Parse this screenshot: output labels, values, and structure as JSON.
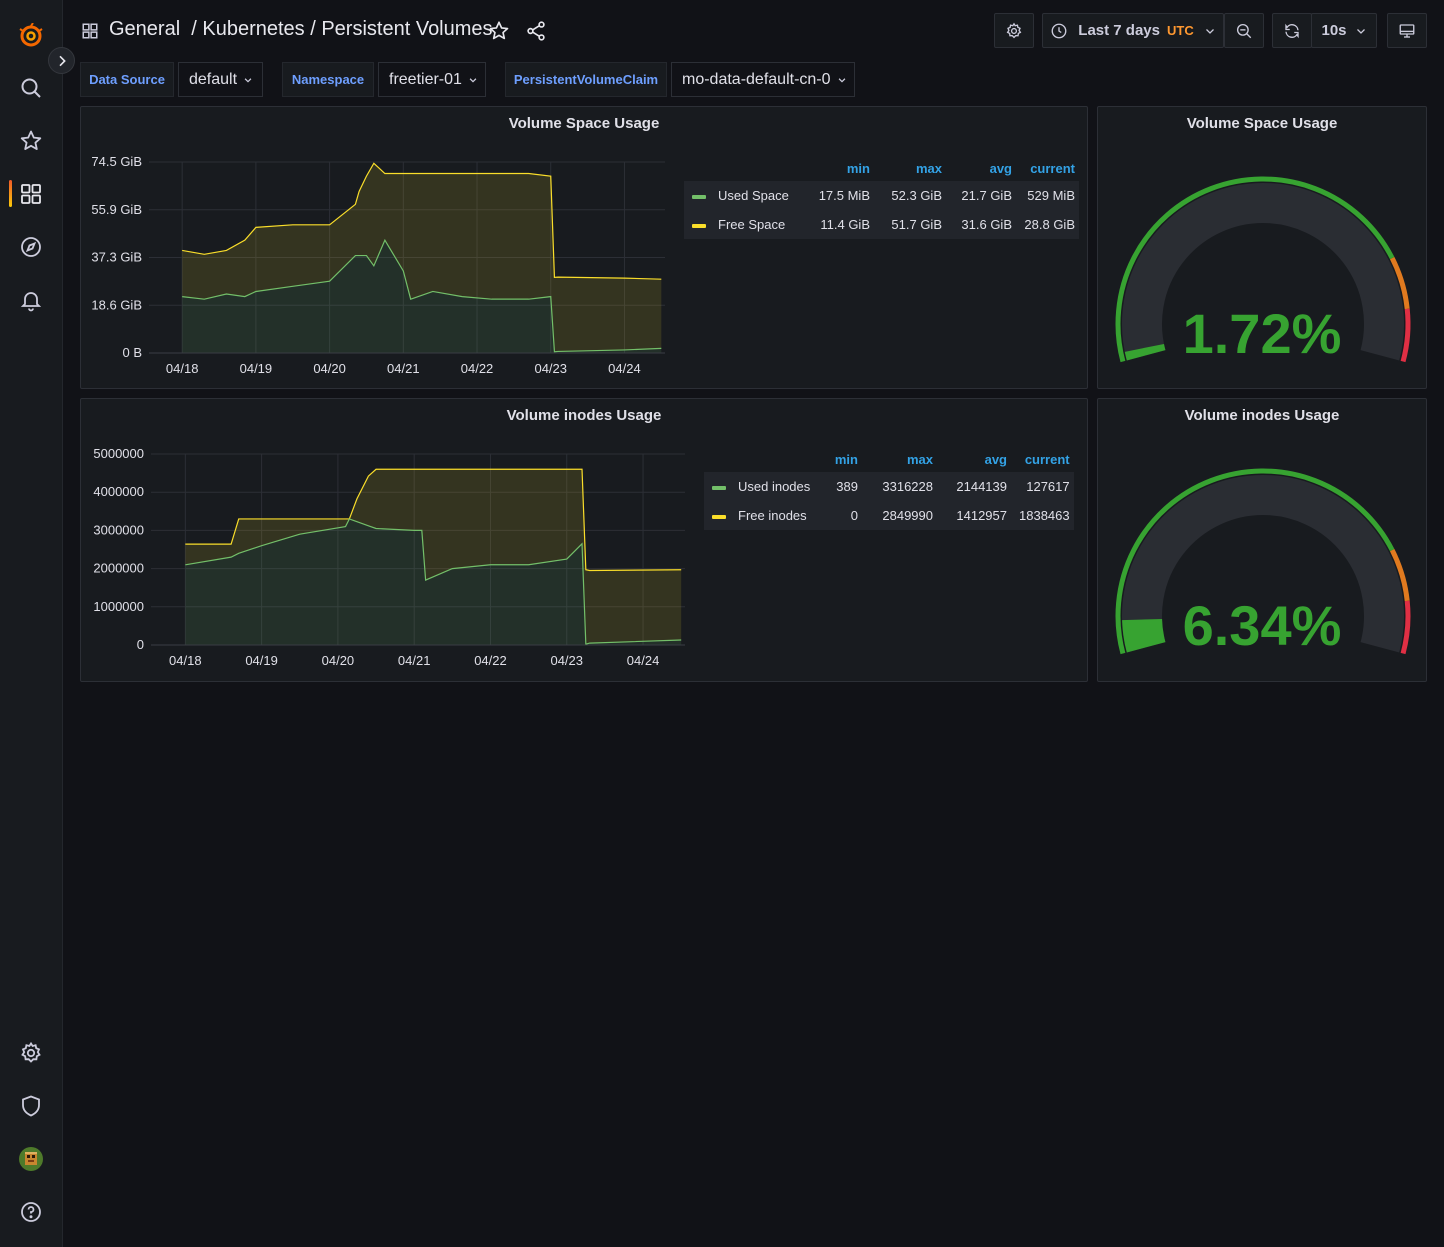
{
  "breadcrumb": {
    "text": "General  / Kubernetes / Persistent Volumes"
  },
  "toolbar": {
    "time_range": "Last 7 days",
    "timezone": "UTC",
    "refresh_interval": "10s"
  },
  "variables": [
    {
      "label": "Data Source",
      "value": "default"
    },
    {
      "label": "Namespace",
      "value": "freetier-01"
    },
    {
      "label": "PersistentVolumeClaim",
      "value": "mo-data-default-cn-0"
    }
  ],
  "colors": {
    "used": "#73bf69",
    "free": "#fade2a",
    "gauge_green": "#37a331",
    "gauge_orange": "#e07a1f",
    "gauge_red": "#e02f44",
    "accent": "#33a2e5"
  },
  "space_panel": {
    "title": "Volume Space Usage",
    "legend_headers": [
      "min",
      "max",
      "avg",
      "current"
    ],
    "legend": [
      {
        "name": "Used Space",
        "min": "17.5 MiB",
        "max": "52.3 GiB",
        "avg": "21.7 GiB",
        "current": "529 MiB"
      },
      {
        "name": "Free Space",
        "min": "11.4 GiB",
        "max": "51.7 GiB",
        "avg": "31.6 GiB",
        "current": "28.8 GiB"
      }
    ]
  },
  "inodes_panel": {
    "title": "Volume inodes Usage",
    "legend_headers": [
      "min",
      "max",
      "avg",
      "current"
    ],
    "legend": [
      {
        "name": "Used inodes",
        "min": "389",
        "max": "3316228",
        "avg": "2144139",
        "current": "127617"
      },
      {
        "name": "Free inodes",
        "min": "0",
        "max": "2849990",
        "avg": "1412957",
        "current": "1838463"
      }
    ]
  },
  "space_gauge": {
    "title": "Volume Space Usage",
    "value_text": "1.72%",
    "value": 1.72
  },
  "inodes_gauge": {
    "title": "Volume inodes Usage",
    "value_text": "6.34%",
    "value": 6.34
  },
  "chart_data": [
    {
      "type": "area",
      "title": "Volume Space Usage",
      "x_labels": [
        "04/18",
        "04/19",
        "04/20",
        "04/21",
        "04/22",
        "04/23",
        "04/24"
      ],
      "y_ticks": [
        "74.5 GiB",
        "55.9 GiB",
        "37.3 GiB",
        "18.6 GiB",
        "0 B"
      ],
      "ylim": [
        0,
        74.5
      ],
      "y_unit": "GiB",
      "stacked": true,
      "series": [
        {
          "name": "Used Space",
          "x": [
            0,
            0.3,
            0.6,
            0.85,
            1.0,
            1.5,
            2.0,
            2.35,
            2.4,
            2.5,
            2.6,
            2.75,
            3.0,
            3.1,
            3.4,
            3.8,
            4.2,
            4.7,
            5.0,
            5.05,
            5.1,
            6.0,
            6.5
          ],
          "values": [
            22,
            21,
            23,
            22,
            24,
            26,
            28,
            38,
            38,
            38,
            34,
            44,
            32,
            21,
            24,
            22,
            21,
            21,
            22,
            0.5,
            0.6,
            1.2,
            1.8
          ]
        },
        {
          "name": "Free Space",
          "x": [
            0,
            0.6,
            1.0,
            1.5,
            2.0,
            2.35,
            2.4,
            2.5,
            2.6,
            2.75,
            3.0,
            3.1,
            3.4,
            3.8,
            4.2,
            4.7,
            5.0,
            5.05,
            5.1,
            6.0,
            6.5
          ],
          "values": [
            18,
            17,
            25,
            24,
            22,
            20,
            25,
            31,
            40,
            26,
            38,
            49,
            46,
            48,
            49,
            49,
            47,
            29,
            29,
            28,
            27
          ]
        }
      ]
    },
    {
      "type": "area",
      "title": "Volume inodes Usage",
      "x_labels": [
        "04/18",
        "04/19",
        "04/20",
        "04/21",
        "04/22",
        "04/23",
        "04/24"
      ],
      "y_ticks": [
        "5000000",
        "4000000",
        "3000000",
        "2000000",
        "1000000",
        "0"
      ],
      "ylim": [
        0,
        5000000
      ],
      "stacked": true,
      "series": [
        {
          "name": "Used inodes",
          "x": [
            0,
            0.6,
            0.7,
            1.0,
            1.5,
            2.1,
            2.15,
            2.5,
            3.0,
            3.1,
            3.15,
            3.5,
            4.0,
            4.5,
            5.0,
            5.2,
            5.25,
            5.3,
            6.5
          ],
          "values": [
            2100000,
            2300000,
            2400000,
            2600000,
            2900000,
            3100000,
            3300000,
            3050000,
            3000000,
            3000000,
            1700000,
            2000000,
            2100000,
            2100000,
            2250000,
            2650000,
            20000,
            50000,
            130000
          ]
        },
        {
          "name": "Free inodes",
          "x": [
            0,
            0.6,
            0.7,
            1.0,
            1.5,
            2.1,
            2.15,
            2.25,
            2.4,
            2.5,
            3.0,
            3.1,
            3.15,
            3.5,
            4.0,
            4.5,
            5.0,
            5.2,
            5.25,
            5.3,
            6.5
          ],
          "values": [
            540000,
            340000,
            900000,
            700000,
            400000,
            200000,
            0,
            600000,
            1300000,
            1550000,
            1600000,
            1600000,
            2900000,
            2600000,
            2500000,
            2500000,
            2350000,
            1950000,
            1950000,
            1900000,
            1840000
          ]
        }
      ]
    }
  ]
}
